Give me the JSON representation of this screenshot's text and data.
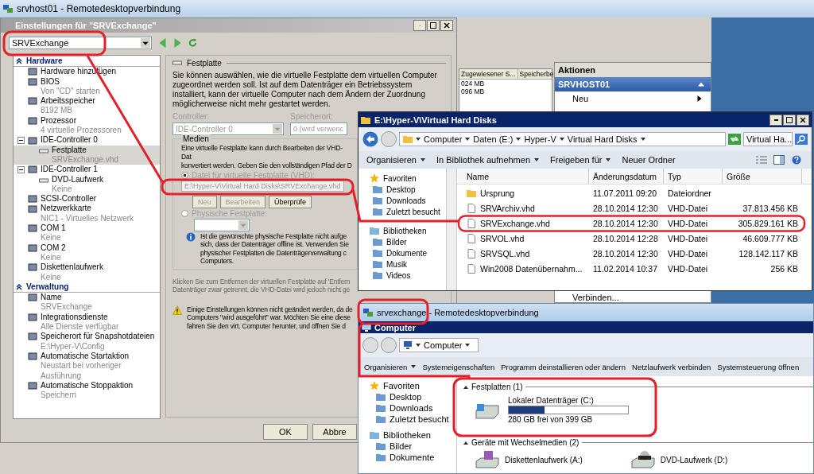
{
  "rdp_window": {
    "title": "srvhost01 - Remotedesktopverbindung"
  },
  "hyperv_manager": {
    "columns": [
      "Zugewiesener S...",
      "Speicherbe"
    ],
    "cells": [
      "024 MB",
      "096 MB"
    ],
    "actions": {
      "header": "Aktionen",
      "host": "SRVHOST01",
      "items": [
        {
          "label": "Neu",
          "submenu": true
        },
        {
          "label": "Verbinden...",
          "submenu": false
        }
      ]
    }
  },
  "settings_dialog": {
    "title": "Einstellungen für \"SRVExchange\"",
    "vm_select": "SRVExchange",
    "tree": [
      {
        "label": "Hardware",
        "expanded": true,
        "items": [
          {
            "name": "Hardware hinzufügen",
            "selected": false
          },
          {
            "name": "BIOS",
            "detail": "Von \"CD\" starten",
            "selected": false
          },
          {
            "name": "Arbeitsspeicher",
            "detail": "8192 MB",
            "selected": false
          },
          {
            "name": "Prozessor",
            "detail": "4 virtuelle Prozessoren",
            "selected": false
          },
          {
            "name": "IDE-Controller 0",
            "selected": false,
            "expanded": true,
            "children": [
              {
                "name": "Festplatte",
                "detail": "SRVExchange.vhd",
                "selected": true
              }
            ]
          },
          {
            "name": "IDE-Controller 1",
            "selected": false,
            "expanded": true,
            "children": [
              {
                "name": "DVD-Laufwerk",
                "detail": "Keine",
                "selected": false
              }
            ]
          },
          {
            "name": "SCSI-Controller",
            "selected": false
          },
          {
            "name": "Netzwerkkarte",
            "detail": "NIC1 - Virtuelles Netzwerk",
            "selected": false
          },
          {
            "name": "COM 1",
            "detail": "Keine",
            "selected": false
          },
          {
            "name": "COM 2",
            "detail": "Keine",
            "selected": false
          },
          {
            "name": "Diskettenlaufwerk",
            "detail": "Keine",
            "selected": false
          }
        ]
      },
      {
        "label": "Verwaltung",
        "expanded": true,
        "items": [
          {
            "name": "Name",
            "detail": "SRVExchange",
            "selected": false
          },
          {
            "name": "Integrationsdienste",
            "detail": "Alle Dienste verfügbar",
            "selected": false
          },
          {
            "name": "Speicherort für Snapshotdateien",
            "detail": "E:\\Hyper-V\\Config",
            "selected": false
          },
          {
            "name": "Automatische Startaktion",
            "detail": "Neustart bei vorheriger Ausführung",
            "selected": false
          },
          {
            "name": "Automatische Stoppaktion",
            "detail": "Speichern",
            "selected": false
          }
        ]
      }
    ],
    "panel": {
      "group": "Festplatte",
      "description": "Sie können auswählen, wie die virtuelle Festplatte dem virtuellen Computer zugeordnet werden soll. Ist auf dem Datenträger ein Betriebssystem installiert, kann der virtuelle Computer nach dem Ändern der Zuordnung möglicherweise nicht mehr gestartet werden.",
      "controller": {
        "label": "Controller:",
        "value": "IDE-Controller 0",
        "disabled": true
      },
      "location": {
        "label": "Speicherort:",
        "value": "0 (wird verwenc",
        "disabled": true
      },
      "media": {
        "label": "Medien",
        "lines": [
          "Eine virtuelle Festplatte kann durch Bearbeiten der VHD-Dat",
          "konvertiert werden. Geben Sie den vollständigen Pfad der D"
        ],
        "options": [
          {
            "label": "Datei für virtuelle Festplatte (VHD):",
            "selected": true,
            "disabled": true
          },
          {
            "label": "Physische Festplatte:",
            "selected": false,
            "disabled": true
          }
        ],
        "path": {
          "value": "E:\\Hyper-V\\Virtual Hard Disks\\SRVExchange.vhd",
          "disabled": true
        },
        "buttons": [
          {
            "label": "Neu",
            "disabled": true
          },
          {
            "label": "Bearbeiten",
            "disabled": true
          },
          {
            "label": "Überprüfe",
            "disabled": false
          }
        ],
        "info_lines": [
          "Ist die gewünschte physische Festplatte nicht aufge",
          "sich, dass der Datenträger offline ist. Verwenden Sie",
          "physischer Festplatten die Datenträgerverwaltung c",
          "Computers."
        ]
      },
      "remove_lines": [
        "Klicken Sie zum Entfernen der virtuellen Festplatte auf 'Entfern",
        "Datenträger zwar getrennt, die VHD-Datei wird jedoch nicht ge"
      ],
      "warning_lines": [
        "Einige Einstellungen können nicht geändert werden, da de",
        "Computers \"wird ausgeführt\" war. Möchten Sie eine diese",
        "fahren Sie den virt. Computer herunter, und öffnen Sie d"
      ]
    },
    "buttons": [
      "OK",
      "Abbre"
    ]
  },
  "explorer": {
    "title": "E:\\Hyper-V\\Virtual Hard Disks",
    "breadcrumb": [
      "Computer",
      "Daten (E:)",
      "Hyper-V",
      "Virtual Hard Disks"
    ],
    "search": "Virtual Ha...",
    "toolbar": [
      "Organisieren",
      "In Bibliothek aufnehmen",
      "Freigeben für",
      "Neuer Ordner"
    ],
    "nav": [
      {
        "label": "Favoriten",
        "kind": "favorites",
        "items": [
          "Desktop",
          "Downloads",
          "Zuletzt besucht"
        ]
      },
      {
        "label": "Bibliotheken",
        "kind": "libraries",
        "items": [
          "Bilder",
          "Dokumente",
          "Musik",
          "Videos"
        ]
      }
    ],
    "columns": [
      "Name",
      "Änderungsdatum",
      "Typ",
      "Größe"
    ],
    "rows": [
      {
        "kind": "folder",
        "name": "Ursprung",
        "date": "11.07.2011 09:20",
        "type": "Dateiordner",
        "size": ""
      },
      {
        "kind": "file",
        "name": "SRVArchiv.vhd",
        "date": "28.10.2014 12:30",
        "type": "VHD-Datei",
        "size": "37.813.456 KB"
      },
      {
        "kind": "file",
        "name": "SRVExchange.vhd",
        "date": "28.10.2014 12:30",
        "type": "VHD-Datei",
        "size": "305.829.161 KB"
      },
      {
        "kind": "file",
        "name": "SRVOL.vhd",
        "date": "28.10.2014 12:28",
        "type": "VHD-Datei",
        "size": "46.609.777 KB"
      },
      {
        "kind": "file",
        "name": "SRVSQL.vhd",
        "date": "28.10.2014 12:30",
        "type": "VHD-Datei",
        "size": "128.142.117 KB"
      },
      {
        "kind": "file",
        "name": "Win2008 Datenübernahm...",
        "date": "11.02.2014 10:37",
        "type": "VHD-Datei",
        "size": "256 KB"
      }
    ]
  },
  "remote_session": {
    "title": "srvexchange - Remotedesktopverbindung",
    "window_title": "Computer",
    "breadcrumb": [
      "Computer"
    ],
    "toolbar": [
      {
        "label": "Organisieren",
        "menu": true
      },
      {
        "label": "Systemeigenschaften",
        "menu": false
      },
      {
        "label": "Programm deinstallieren oder ändern",
        "menu": false
      },
      {
        "label": "Netzlaufwerk verbinden",
        "menu": false
      },
      {
        "label": "Systemsteuerung öffnen",
        "menu": false
      }
    ],
    "nav": [
      {
        "label": "Favoriten",
        "kind": "favorites",
        "items": [
          "Desktop",
          "Downloads",
          "Zuletzt besucht"
        ]
      },
      {
        "label": "Bibliotheken",
        "kind": "libraries",
        "items": [
          "Bilder",
          "Dokumente"
        ]
      }
    ],
    "hard_disks": {
      "label": "Festplatten (1)",
      "drives": [
        {
          "name": "Lokaler Datenträger (C:)",
          "level": 0.3,
          "free": "280 GB frei von 399 GB"
        }
      ]
    },
    "removable": {
      "label": "Geräte mit Wechselmedien (2)",
      "drives": [
        {
          "name": "Diskettenlaufwerk (A:)",
          "kind": "floppy"
        },
        {
          "name": "DVD-Laufwerk (D:)",
          "kind": "dvd"
        }
      ]
    }
  }
}
